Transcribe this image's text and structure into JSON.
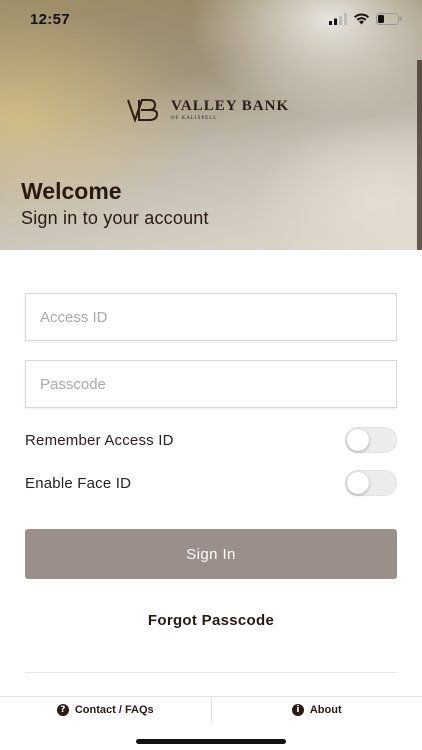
{
  "status_bar": {
    "time": "12:57",
    "icons": [
      "signal-icon",
      "wifi-icon",
      "battery-icon"
    ]
  },
  "brand": {
    "name": "Valley Bank",
    "subtitle": "of Kalispell",
    "mark": "VB"
  },
  "hero": {
    "title": "Welcome",
    "subtitle": "Sign in to your account"
  },
  "form": {
    "access_id": {
      "value": "",
      "placeholder": "Access ID"
    },
    "passcode": {
      "value": "",
      "placeholder": "Passcode"
    },
    "remember_label": "Remember Access ID",
    "remember_on": false,
    "face_id_label": "Enable Face ID",
    "face_id_on": false,
    "sign_in_label": "Sign In",
    "forgot_label": "Forgot Passcode"
  },
  "footer": {
    "contact_label": "Contact / FAQs",
    "contact_icon": "question-circle-icon",
    "about_label": "About",
    "about_icon": "info-circle-icon"
  },
  "colors": {
    "primary_button": "#9a8f8b",
    "text_dark": "#2a1a12",
    "toggle_off": "#ececec"
  }
}
